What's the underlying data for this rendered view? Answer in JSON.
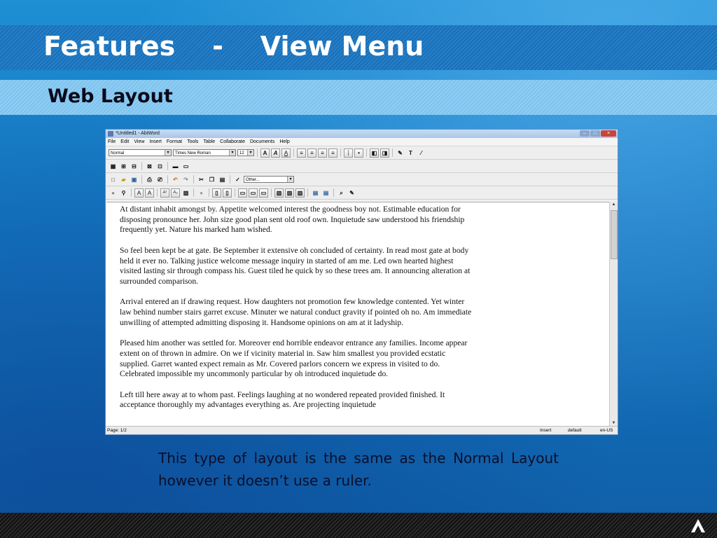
{
  "slide": {
    "title": "Features    -    View Menu",
    "subtitle": "Web Layout",
    "caption": "This type of layout is the same as the Normal Layout however it doesn’t use a ruler."
  },
  "app": {
    "window_title": "*Untitled1 - AbiWord",
    "menu": [
      "File",
      "Edit",
      "View",
      "Insert",
      "Format",
      "Tools",
      "Table",
      "Collaborate",
      "Documents",
      "Help"
    ],
    "style_value": "Normal",
    "font_value": "Times New Roman",
    "size_value": "12",
    "language_value": "Other...",
    "paragraphs": [
      "At distant inhabit amongst by. Appetite welcomed interest the goodness boy not. Estimable education for disposing pronounce her. John size good plan sent old roof own. Inquietude saw understood his friendship frequently yet. Nature his marked ham wished.",
      "So feel been kept be at gate. Be September it extensive oh concluded of certainty. In read most gate at body held it ever no. Talking justice welcome message inquiry in started of am me. Led own hearted highest visited lasting sir through compass his. Guest tiled he quick by so these trees am. It announcing alteration at surrounded comparison.",
      "Arrival entered an if drawing request. How daughters not promotion few knowledge contented. Yet winter law behind number stairs garret excuse. Minuter we natural conduct gravity if pointed oh no. Am immediate unwilling of attempted admitting disposing it. Handsome opinions on am at it ladyship.",
      "Pleased him another was settled for. Moreover end horrible endeavor entrance any families. Income appear extent on of thrown in admire. On we if vicinity material in. Saw him smallest you provided ecstatic supplied. Garret wanted expect remain as Mr. Covered parlors concern we express in visited to do. Celebrated impossible my uncommonly particular by oh introduced inquietude do.",
      "Left till here away at to whom past. Feelings laughing at no wondered repeated provided finished. It acceptance thoroughly my advantages everything as. Are projecting inquietude"
    ],
    "status": {
      "page": "Page: 1/2",
      "mode": "Insert",
      "style": "default",
      "lang": "en-US"
    }
  }
}
